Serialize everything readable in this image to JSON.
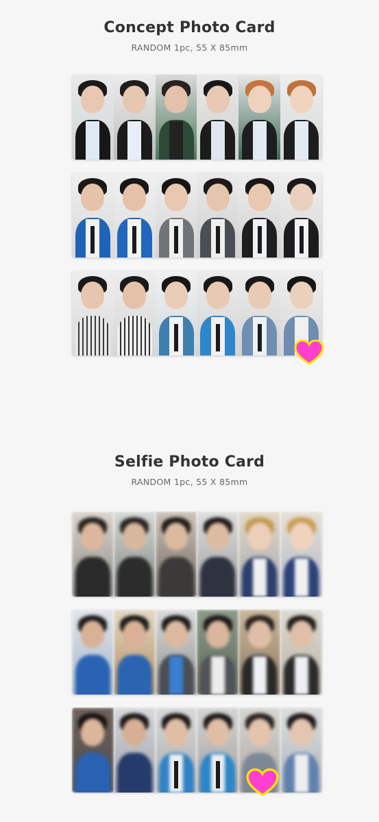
{
  "sections": [
    {
      "title": "Concept Photo Card",
      "subtitle": "RANDOM 1pc, 55 X 85mm"
    },
    {
      "title": "Selfie Photo Card",
      "subtitle": "RANDOM 1pc, 55 X 85mm"
    }
  ],
  "colors": {
    "background": "#f6f6f6",
    "title": "#333333",
    "subtitle": "#666666",
    "heart_fill": "#ff3fd0",
    "heart_outline": "#ffe600"
  }
}
